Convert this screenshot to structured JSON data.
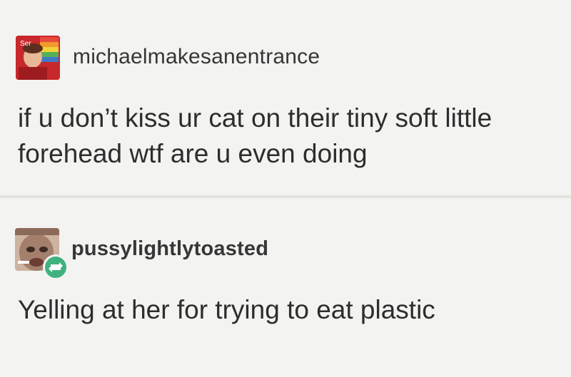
{
  "posts": [
    {
      "username": "michaelmakesanentrance",
      "body_lines": [
        "if u don’t kiss ur cat on their tiny soft little",
        "forehead wtf are u even doing"
      ]
    },
    {
      "username": "pussylightlytoasted",
      "body_lines": [
        "Yelling at her for trying to eat plastic"
      ],
      "badge_icon": "reblog-icon",
      "badge_color": "#3fb27f"
    }
  ]
}
